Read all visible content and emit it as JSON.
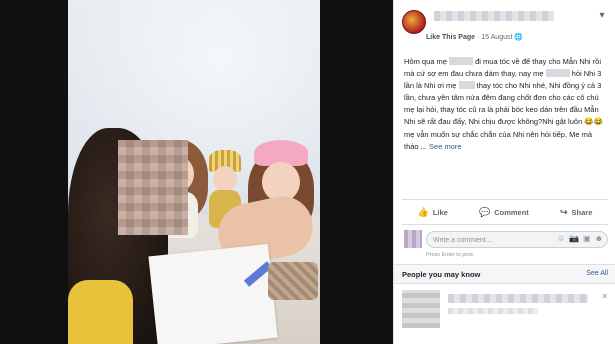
{
  "post": {
    "page_name": "",
    "like_page_label": "Like This Page",
    "separator": "·",
    "date": "15 August",
    "privacy_icon": "globe-icon",
    "text": "Hôm qua mẹ đi mua tóc về để thay cho Mẫn Nhi rồi mà cứ sợ em đau chưa dám thay, nay mẹ hỏi Nhi 3 lần là Nhi ơi mẹ thay tóc cho Nhi nhé, Nhi đồng ý cả 3 lần, chưa yên tâm nửa đêm đang chốt đơn cho các cô chú mẹ lại hỏi, thay tóc cũ ra là phải bóc keo dán trên đầu Mẫn Nhi sẽ rất đau đấy, Nhi chịu được không?Nhi gật luôn 😂😂 mẹ vẫn muốn sự chắc chắn của Nhi nên hỏi tiếp, Me mà thảo ...",
    "text_parts": {
      "p1": "Hôm qua mẹ",
      "p2": "đi mua tóc về để thay cho Mẫn Nhi rồi mà cứ sợ em đau chưa dám thay, nay mẹ",
      "p3": "hỏi Nhi 3 lần là Nhi ơi mẹ",
      "p4": "thay tóc cho Nhi nhé, Nhi đồng ý cả 3 lần, chưa yên tâm nửa đêm đang chốt đơn cho các cô chú mẹ lại hỏi, thay tóc cũ ra là phải bóc keo dán trên đầu Mẫn Nhi sẽ rất đau đấy, Nhi chịu được không?Nhi gật luôn 😂😂 mẹ vẫn muốn sự chắc chắn của Nhi nên hỏi tiếp, Me mà thảo ...",
      "see_more": "See more"
    }
  },
  "actions": {
    "like": "Like",
    "comment": "Comment",
    "share": "Share"
  },
  "comment_box": {
    "placeholder": "Write a comment...",
    "hint": "Press Enter to post."
  },
  "people_you_may_know": {
    "title": "People you may know",
    "see_all": "See All"
  },
  "colors": {
    "link": "#385898",
    "panel_bg": "#ffffff",
    "viewer_bg": "#101010"
  }
}
